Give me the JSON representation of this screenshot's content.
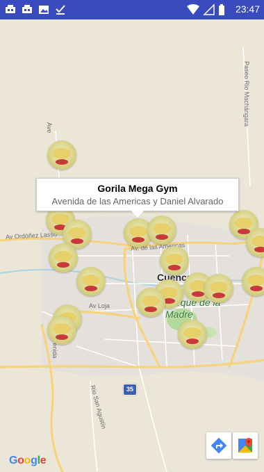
{
  "status_bar": {
    "time": "23:47",
    "icons": [
      "notification-app-icon",
      "notification-app-icon",
      "image-icon",
      "download-done-icon",
      "wifi-icon",
      "signal-icon",
      "battery-icon"
    ]
  },
  "map": {
    "labels": {
      "ave_top": "Ave",
      "paseo": "Paseo Rio Machángara",
      "ordonez": "Av Ordóñez Lasso",
      "americas": "Av. de las Americas",
      "loja": "Av Loja",
      "avenida_left": "Avenida",
      "san_agustin": "Rio San Agustín",
      "city": "Cuenca",
      "park": "Parque de la Madre",
      "highway": "35"
    },
    "info_window": {
      "title": "Gorila Mega Gym",
      "address": "Avenida de las Americas y Daniel Alvarado"
    },
    "marker_count": 20,
    "google_logo": "Google"
  },
  "colors": {
    "status_bar": "#3a4bc0",
    "map_bg": "#ebe6d8",
    "road_main": "#f7d27c",
    "park": "#b5d89b",
    "directions_blue": "#4285f4"
  }
}
